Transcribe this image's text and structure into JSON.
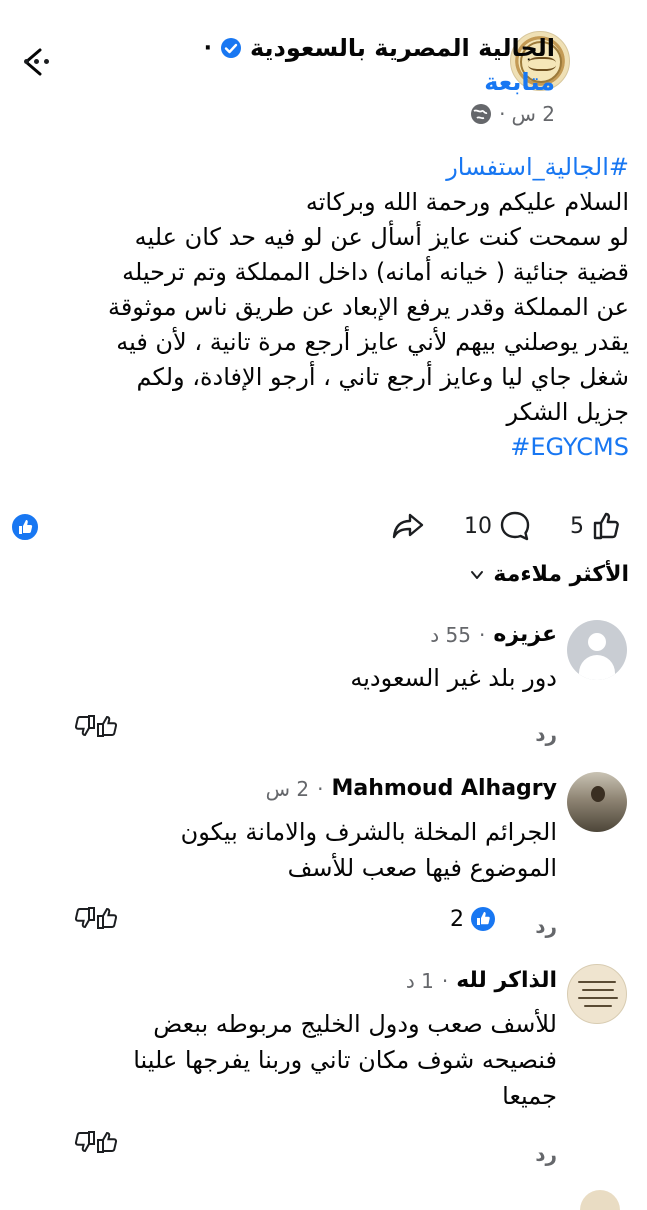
{
  "header": {
    "page_name": "الجالية المصرية بالسعودية",
    "separator": "·",
    "follow_label": "متابعة",
    "post_time": "2 س",
    "meta_separator": "·"
  },
  "post": {
    "lines": [
      "#الجالية_استفسار",
      "السلام عليكم ورحمة الله وبركاته",
      "لو سمحت كنت عايز أسأل عن لو فيه حد كان عليه",
      "قضية جنائية ( خيانه أمانه) داخل المملكة وتم ترحيله",
      "عن المملكة وقدر يرفع الإبعاد عن طريق ناس موثوقة",
      "يقدر يوصلني بيهم لأني عايز أرجع مرة تانية ، لأن فيه",
      "شغل جاي ليا وعايز أرجع تاني ، أرجو الإفادة، ولكم",
      "جزيل الشكر",
      "#EGYCMS"
    ],
    "reactions": {
      "likes": "5",
      "comments": "10"
    }
  },
  "sort": {
    "label": "الأكثر ملاءمة"
  },
  "comments": [
    {
      "name": "عزيزه",
      "time": "55 د",
      "sep": "·",
      "lines": [
        "دور بلد غير السعوديه"
      ],
      "reply_label": "رد",
      "likes": ""
    },
    {
      "name": "Mahmoud Alhagry",
      "time": "2 س",
      "sep": "·",
      "lines": [
        "الجرائم المخلة بالشرف والامانة بيكون",
        "الموضوع فيها صعب للأسف"
      ],
      "reply_label": "رد",
      "likes": "2"
    },
    {
      "name": "الذاكر لله",
      "time": "1 د",
      "sep": "·",
      "lines": [
        "للأسف صعب ودول الخليج مربوطه ببعض",
        "فنصيحه شوف مكان تاني وربنا يفرجها علينا",
        "جميعا"
      ],
      "reply_label": "رد",
      "likes": ""
    }
  ],
  "colors": {
    "accent": "#1877f2",
    "muted": "#65676b"
  }
}
